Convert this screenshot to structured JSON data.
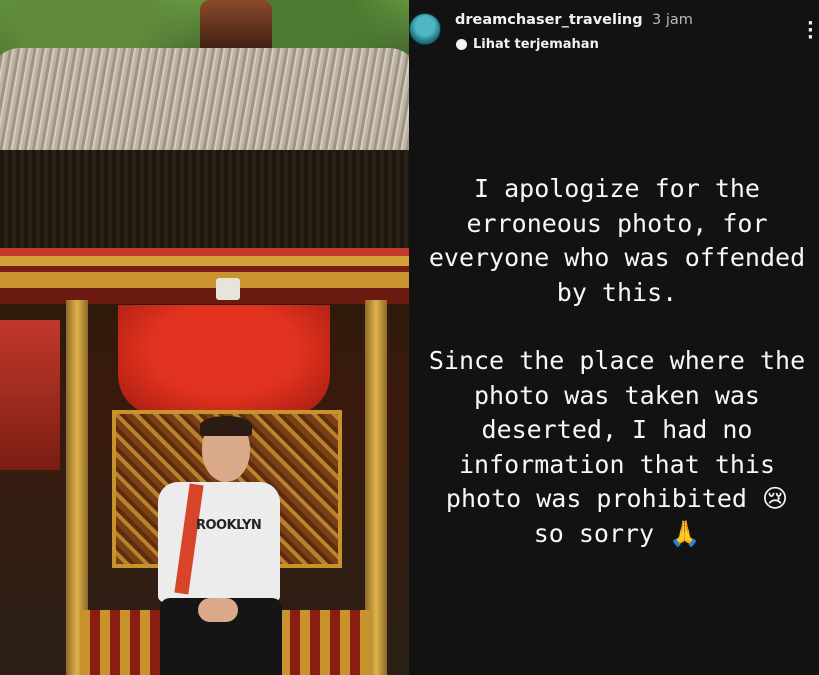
{
  "header": {
    "username": "dreamchaser_traveling",
    "time": "3 jam",
    "translate_label": "Lihat terjemahan",
    "more_icon": "more-vertical-icon"
  },
  "photo": {
    "shirt_text": "ROOKLYN"
  },
  "story": {
    "paragraph1": "I apologize for the erroneous photo, for everyone who was offended by this.",
    "paragraph2": "Since the place where the photo was taken was deserted, I had no information that this photo was prohibited",
    "emoji_sad": "😢",
    "closing": "so sorry",
    "emoji_pray": "🙏"
  },
  "colors": {
    "background": "#121212",
    "text": "#f7f7f7",
    "time": "#b9b9b9"
  }
}
